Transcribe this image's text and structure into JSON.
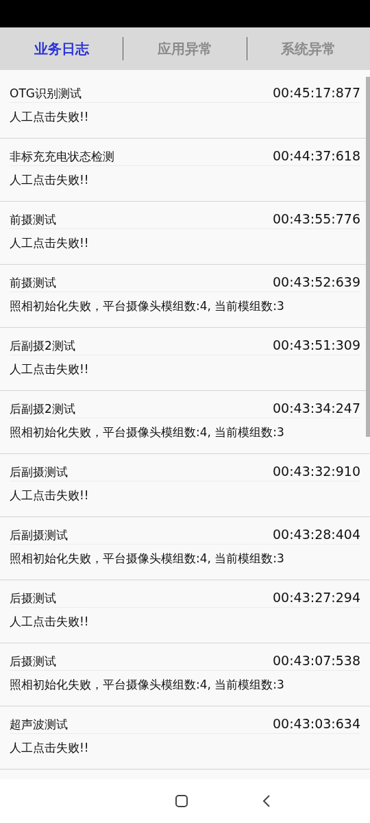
{
  "tabs": [
    {
      "label": "业务日志",
      "selected": true
    },
    {
      "label": "应用异常",
      "selected": false
    },
    {
      "label": "系统异常",
      "selected": false
    }
  ],
  "entries": [
    {
      "title": "OTG识别测试",
      "time": "00:45:17:877",
      "message": "人工点击失败!!"
    },
    {
      "title": "非标充充电状态检测",
      "time": "00:44:37:618",
      "message": "人工点击失败!!"
    },
    {
      "title": "前摄测试",
      "time": "00:43:55:776",
      "message": "人工点击失败!!"
    },
    {
      "title": "前摄测试",
      "time": "00:43:52:639",
      "message": "照相初始化失败，平台摄像头模组数:4, 当前模组数:3"
    },
    {
      "title": "后副摄2测试",
      "time": "00:43:51:309",
      "message": "人工点击失败!!"
    },
    {
      "title": "后副摄2测试",
      "time": "00:43:34:247",
      "message": "照相初始化失败，平台摄像头模组数:4, 当前模组数:3"
    },
    {
      "title": "后副摄测试",
      "time": "00:43:32:910",
      "message": "人工点击失败!!"
    },
    {
      "title": "后副摄测试",
      "time": "00:43:28:404",
      "message": "照相初始化失败，平台摄像头模组数:4, 当前模组数:3"
    },
    {
      "title": "后摄测试",
      "time": "00:43:27:294",
      "message": "人工点击失败!!"
    },
    {
      "title": "后摄测试",
      "time": "00:43:07:538",
      "message": "照相初始化失败，平台摄像头模组数:4, 当前模组数:3"
    },
    {
      "title": "超声波测试",
      "time": "00:43:03:634",
      "message": "人工点击失败!!"
    }
  ]
}
